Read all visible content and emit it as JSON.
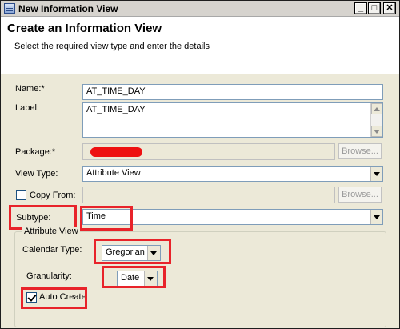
{
  "window": {
    "title": "New Information View",
    "controls": {
      "minimize": "_",
      "maximize": "□",
      "close": "✕"
    }
  },
  "header": {
    "title": "Create an Information View",
    "description": "Select the required view type and enter the details"
  },
  "form": {
    "name": {
      "label": "Name:*",
      "value": "AT_TIME_DAY"
    },
    "label_field": {
      "label": "Label:",
      "value": "AT_TIME_DAY"
    },
    "package": {
      "label": "Package:*",
      "value": "",
      "browse": "Browse..."
    },
    "view_type": {
      "label": "View Type:",
      "value": "Attribute View"
    },
    "copy_from": {
      "label": "Copy From:",
      "checked": false,
      "value": "",
      "browse": "Browse..."
    },
    "subtype": {
      "label": "Subtype:",
      "value": "Time"
    }
  },
  "attribute_view": {
    "legend": "Attribute View",
    "calendar_type": {
      "label": "Calendar Type:",
      "value": "Gregorian"
    },
    "granularity": {
      "label": "Granularity:",
      "value": "Date"
    },
    "auto_create": {
      "label": "Auto Create",
      "checked": true
    }
  },
  "colors": {
    "highlight": "#e8232a",
    "redaction": "#ee1111"
  }
}
